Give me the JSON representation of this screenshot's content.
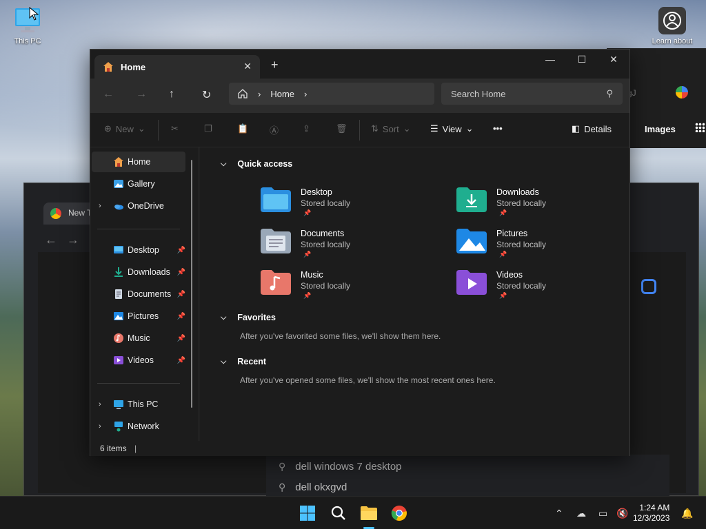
{
  "desktop": {
    "icons": [
      {
        "label": "This PC"
      },
      {
        "label": "Learn about"
      }
    ]
  },
  "background_browser": {
    "tab_label": "New T",
    "images_label": "Images",
    "partial_left": "il",
    "address_fragment": "gJ",
    "suggestions": [
      "dell windows 7 desktop",
      "dell okxgvd"
    ]
  },
  "explorer": {
    "tab_title": "Home",
    "breadcrumb": [
      "Home"
    ],
    "search_placeholder": "Search Home",
    "toolbar": {
      "new": "New",
      "sort": "Sort",
      "view": "View",
      "more": "•••",
      "details": "Details"
    },
    "sidebar": {
      "top": [
        {
          "label": "Home",
          "icon": "home-icon",
          "selected": true
        },
        {
          "label": "Gallery",
          "icon": "gallery-icon"
        },
        {
          "label": "OneDrive",
          "icon": "onedrive-icon",
          "expandable": true
        }
      ],
      "pinned": [
        {
          "label": "Desktop",
          "icon": "desktop-folder-icon"
        },
        {
          "label": "Downloads",
          "icon": "downloads-icon"
        },
        {
          "label": "Documents",
          "icon": "documents-icon"
        },
        {
          "label": "Pictures",
          "icon": "pictures-icon"
        },
        {
          "label": "Music",
          "icon": "music-icon"
        },
        {
          "label": "Videos",
          "icon": "videos-icon"
        }
      ],
      "bottom": [
        {
          "label": "This PC",
          "icon": "this-pc-icon"
        },
        {
          "label": "Network",
          "icon": "network-icon"
        }
      ]
    },
    "sections": {
      "quick_access": {
        "title": "Quick access",
        "items": [
          {
            "name": "Desktop",
            "status": "Stored locally",
            "color": "#2b8fe0"
          },
          {
            "name": "Downloads",
            "status": "Stored locally",
            "color": "#1fae8f"
          },
          {
            "name": "Documents",
            "status": "Stored locally",
            "color": "#9aa8b8"
          },
          {
            "name": "Pictures",
            "status": "Stored locally",
            "color": "#1e88e5"
          },
          {
            "name": "Music",
            "status": "Stored locally",
            "color": "#e8776a"
          },
          {
            "name": "Videos",
            "status": "Stored locally",
            "color": "#8a4fd8"
          }
        ]
      },
      "favorites": {
        "title": "Favorites",
        "note": "After you've favorited some files, we'll show them here."
      },
      "recent": {
        "title": "Recent",
        "note": "After you've opened some files, we'll show the most recent ones here."
      }
    },
    "status": "6 items"
  },
  "taskbar": {
    "time": "1:24 AM",
    "date": "12/3/2023"
  },
  "colors": {
    "accent": "#4cc2ff",
    "window_bg": "#1c1c1c"
  }
}
